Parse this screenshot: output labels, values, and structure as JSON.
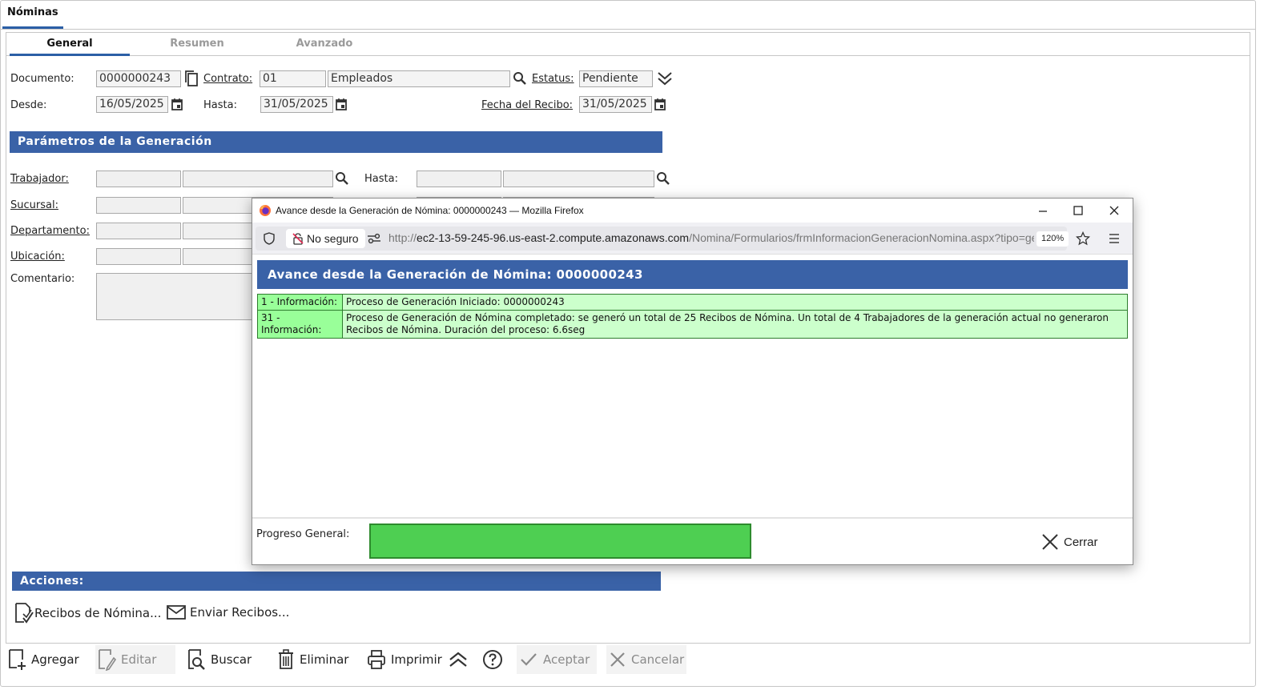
{
  "app": {
    "main_tab": "Nóminas",
    "sub_tabs": [
      "General",
      "Resumen",
      "Avanzado"
    ]
  },
  "header": {
    "documento_label": "Documento:",
    "documento_value": "0000000243",
    "contrato_label": "Contrato:",
    "contrato_code": "01",
    "contrato_name": "Empleados",
    "estatus_label": "Estatus:",
    "estatus_value": "Pendiente",
    "desde_label": "Desde:",
    "desde_value": "16/05/2025",
    "hasta_label": "Hasta:",
    "hasta_value": "31/05/2025",
    "fecha_recibo_label": "Fecha del Recibo:",
    "fecha_recibo_value": "31/05/2025"
  },
  "params": {
    "title": "Parámetros de la Generación",
    "trabajador_label": "Trabajador:",
    "hasta_label": "Hasta:",
    "sucursal_label": "Sucursal:",
    "departamento_label": "Departamento:",
    "ubicacion_label": "Ubicación:",
    "comentario_label": "Comentario:"
  },
  "acciones": {
    "title": "Acciones:",
    "recibos_label": "Recibos de Nómina...",
    "enviar_label": "Enviar Recibos..."
  },
  "toolbar": {
    "agregar": "Agregar",
    "editar": "Editar",
    "buscar": "Buscar",
    "eliminar": "Eliminar",
    "imprimir": "Imprimir",
    "aceptar": "Aceptar",
    "cancelar": "Cancelar"
  },
  "popup": {
    "window_title": "Avance desde la Generación de Nómina: 0000000243 — Mozilla Firefox",
    "no_seguro": "No seguro",
    "url_prefix": "http://",
    "url_host": "ec2-13-59-245-96.us-east-2.compute.amazonaws.com",
    "url_path": "/Nomina/Formularios/frmInformacionGeneracionNomina.aspx?tipo=gen",
    "zoom": "120%",
    "header": "Avance desde la Generación de Nómina: 0000000243",
    "messages": [
      {
        "category": "1 - Información:",
        "text": "Proceso de Generación Iniciado: 0000000243"
      },
      {
        "category": "31 - Información:",
        "text": "Proceso de Generación de Nómina completado: se generó un total de 25 Recibos de Nómina. Un total de 4 Trabajadores de la generación actual no generaron Recibos de Nómina. Duración del proceso: 6.6seg"
      }
    ],
    "progress_label": "Progreso General:",
    "progress_fraction": 1.0,
    "cerrar": "Cerrar"
  },
  "colors": {
    "accent_blue": "#3a62a7",
    "progress_green": "#4ecf52",
    "msg_bg": "#ccffcc",
    "msg_cat_bg": "#99ff99"
  }
}
